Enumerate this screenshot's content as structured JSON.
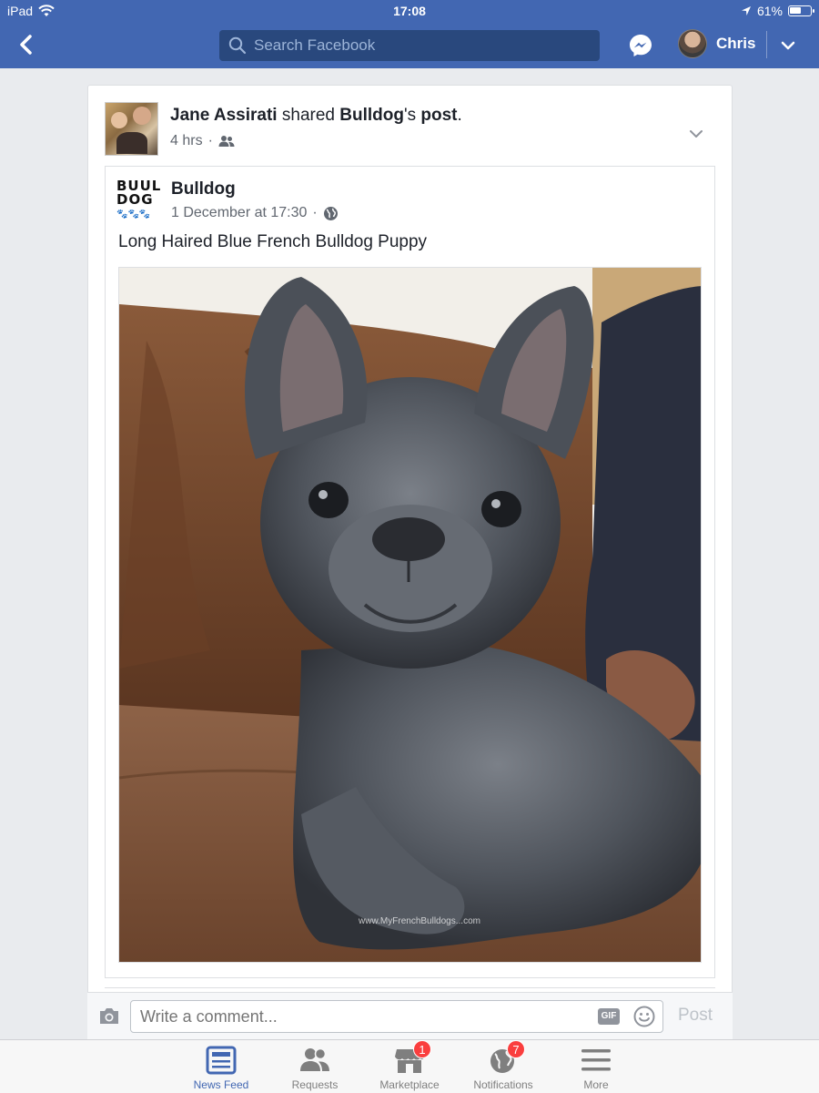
{
  "status_bar": {
    "device": "iPad",
    "time": "17:08",
    "battery": "61%",
    "battery_level": 0.61
  },
  "nav": {
    "search_placeholder": "Search Facebook",
    "profile_name": "Chris"
  },
  "post": {
    "author": "Jane Assirati",
    "action": " shared ",
    "page_ref": "Bulldog",
    "possessive": "'s ",
    "object": "post",
    "period": ".",
    "time": "4 hrs",
    "privacy_icon": "friends-icon"
  },
  "shared_post": {
    "page_name": "Bulldog",
    "logo_line1": "BUUL",
    "logo_line2": "DOG",
    "date": "1 December at 17:30",
    "privacy_icon": "globe-icon",
    "text": "Long Haired Blue French Bulldog Puppy",
    "photo_watermark": "www.MyFrenchBulldogs...com"
  },
  "comment": {
    "placeholder": "Write a comment...",
    "gif_label": "GIF",
    "post_label": "Post"
  },
  "tabs": [
    {
      "label": "News Feed",
      "icon": "news-feed-icon",
      "active": true
    },
    {
      "label": "Requests",
      "icon": "requests-icon"
    },
    {
      "label": "Marketplace",
      "icon": "marketplace-icon",
      "badge": "1"
    },
    {
      "label": "Notifications",
      "icon": "globe-icon",
      "badge": "7"
    },
    {
      "label": "More",
      "icon": "menu-icon"
    }
  ],
  "colors": {
    "brand": "#4267b2",
    "badge": "#fa3e3e"
  }
}
